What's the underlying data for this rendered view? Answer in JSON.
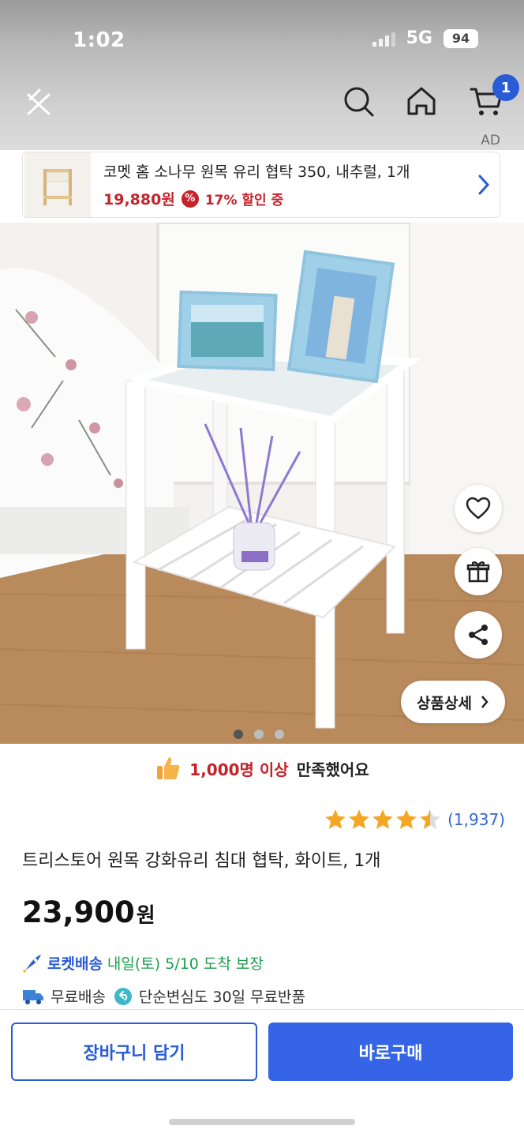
{
  "status_bar": {
    "time": "1:02",
    "network": "5G",
    "battery": "94"
  },
  "header": {
    "cart_count": "1",
    "ad_label": "AD",
    "icons": [
      "back-icon",
      "close-icon",
      "search-icon",
      "home-icon",
      "cart-icon"
    ]
  },
  "ad_banner": {
    "title": "코멧 홈 소나무 원목 유리 협탁 350, 내추럴, 1개",
    "price": "19,880원",
    "discount": "17% 할인 중",
    "discount_icon": "%"
  },
  "gallery": {
    "detail_button": "상품상세",
    "page_count": 3,
    "current_page": 1
  },
  "satisfaction": {
    "count": "1,000명 이상",
    "text": "만족했어요"
  },
  "product": {
    "rating": 4.5,
    "review_count": "(1,937)",
    "title": "트리스토어 원목 강화유리 침대 협탁, 화이트, 1개",
    "price": "23,900",
    "price_unit": "원"
  },
  "delivery": {
    "brand": "로켓배송",
    "date": "내일(토) 5/10 도착 보장"
  },
  "perks": {
    "free_shipping": "무료배송",
    "free_return": "단순변심도 30일 무료반품"
  },
  "actions": {
    "cart": "장바구니 담기",
    "buy": "바로구매"
  },
  "colors": {
    "accent": "#2a5bd7",
    "price_red": "#c5232b",
    "delivery_green": "#1a9e4b",
    "star": "#f5a623"
  }
}
